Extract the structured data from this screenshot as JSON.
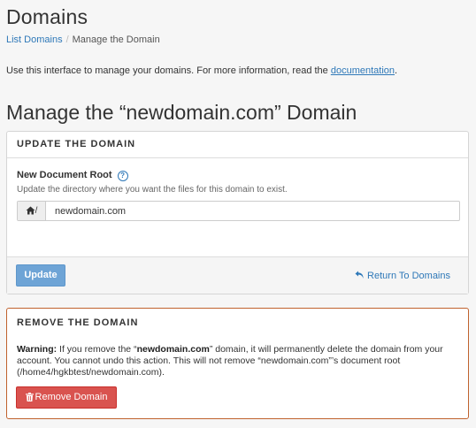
{
  "page": {
    "title": "Domains",
    "breadcrumb": {
      "root": "List Domains",
      "separator": "/",
      "current": "Manage the Domain"
    },
    "intro": {
      "text": "Use this interface to manage your domains. For more information, read the ",
      "link": "documentation",
      "suffix": "."
    },
    "heading": "Manage the “newdomain.com” Domain"
  },
  "update_panel": {
    "header": "UPDATE THE DOMAIN",
    "field_label": "New Document Root",
    "help_glyph": "?",
    "field_help": "Update the directory where you want the files for this domain to exist.",
    "addon_suffix": "/",
    "input_value": "newdomain.com",
    "update_button": "Update",
    "return_link": "Return To Domains"
  },
  "remove_panel": {
    "header": "REMOVE THE DOMAIN",
    "warning_label": "Warning:",
    "warning_part1": " If you remove the “",
    "warning_domain": "newdomain.com",
    "warning_part2": "” domain, it will permanently delete the domain from your account. You cannot undo this action. This will not remove “newdomain.com”’s document root (/home4/hgkbtest/newdomain.com).",
    "remove_button": "Remove Domain"
  },
  "colors": {
    "accent": "#2e78b8",
    "primary_button": "#6ea4d6",
    "danger_button": "#d9534f",
    "danger_border": "#c0622e"
  },
  "icons": {
    "help": "question-circle-icon",
    "home": "home-icon",
    "return": "undo-arrow-icon",
    "trash": "trash-icon"
  }
}
